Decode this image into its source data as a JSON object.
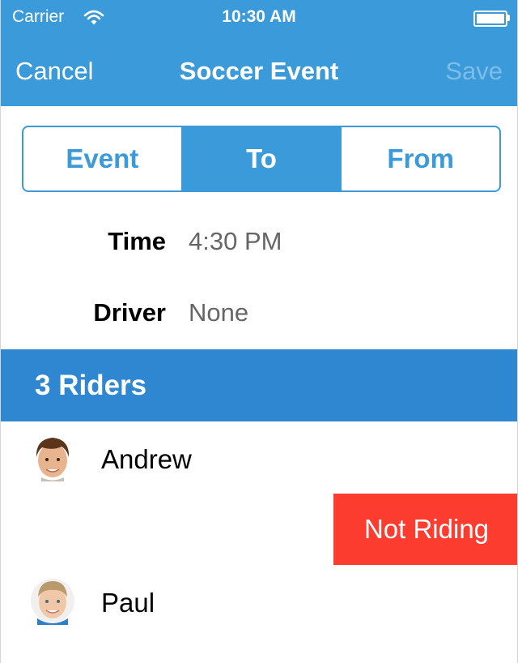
{
  "status_bar": {
    "carrier": "Carrier",
    "time": "10:30 AM",
    "wifi_icon": "wifi-icon",
    "battery_icon": "battery-icon"
  },
  "nav": {
    "left_label": "Cancel",
    "title": "Soccer Event",
    "right_label": "Save"
  },
  "segments": [
    "Event",
    "To",
    "From"
  ],
  "active_segment": "To",
  "fields": {
    "time": {
      "label": "Time",
      "value": "4:30 PM"
    },
    "driver": {
      "label": "Driver",
      "value": "None"
    }
  },
  "riders_header": "3 Riders",
  "riders": [
    {
      "name": "Andrew",
      "avatar_icon": "avatar-andrew"
    },
    {
      "name": "Paul",
      "avatar_icon": "avatar-paul"
    }
  ],
  "swipe_action": {
    "label": "Not Riding"
  },
  "colors": {
    "accent": "#3b9ad9",
    "section": "#2f87d2",
    "destructive": "#fd3c30",
    "disabled": "#7dbde8"
  }
}
